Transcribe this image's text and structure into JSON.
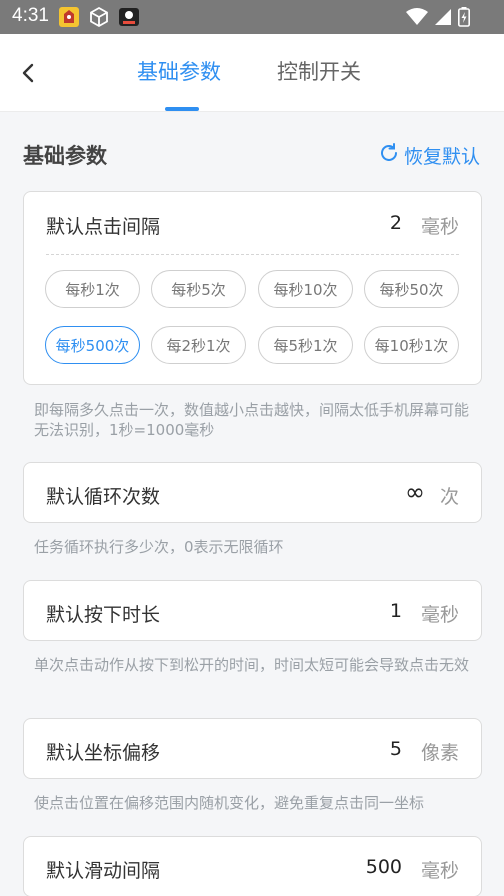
{
  "status_bar": {
    "time": "4:31"
  },
  "tabs": [
    {
      "label": "基础参数"
    },
    {
      "label": "控制开关"
    }
  ],
  "section": {
    "title": "基础参数",
    "restore_label": "恢复默认"
  },
  "click_interval": {
    "label": "默认点击间隔",
    "value": "2",
    "unit": "毫秒",
    "presets": [
      "每秒1次",
      "每秒5次",
      "每秒10次",
      "每秒50次",
      "每秒500次",
      "每2秒1次",
      "每5秒1次",
      "每10秒1次"
    ],
    "selected_preset": "每秒500次",
    "hint": "即每隔多久点击一次，数值越小点击越快，间隔太低手机屏幕可能无法识别，1秒=1000毫秒"
  },
  "loop_count": {
    "label": "默认循环次数",
    "value": "∞",
    "unit": "次",
    "hint": "任务循环执行多少次，0表示无限循环"
  },
  "press_duration": {
    "label": "默认按下时长",
    "value": "1",
    "unit": "毫秒",
    "hint": "单次点击动作从按下到松开的时间，时间太短可能会导致点击无效"
  },
  "coord_offset": {
    "label": "默认坐标偏移",
    "value": "5",
    "unit": "像素",
    "hint": "使点击位置在偏移范围内随机变化，避免重复点击同一坐标"
  },
  "swipe_interval": {
    "label": "默认滑动间隔",
    "value": "500",
    "unit": "毫秒"
  },
  "colors": {
    "accent": "#2f8ff1",
    "status_bar": "#7a7a7a"
  }
}
